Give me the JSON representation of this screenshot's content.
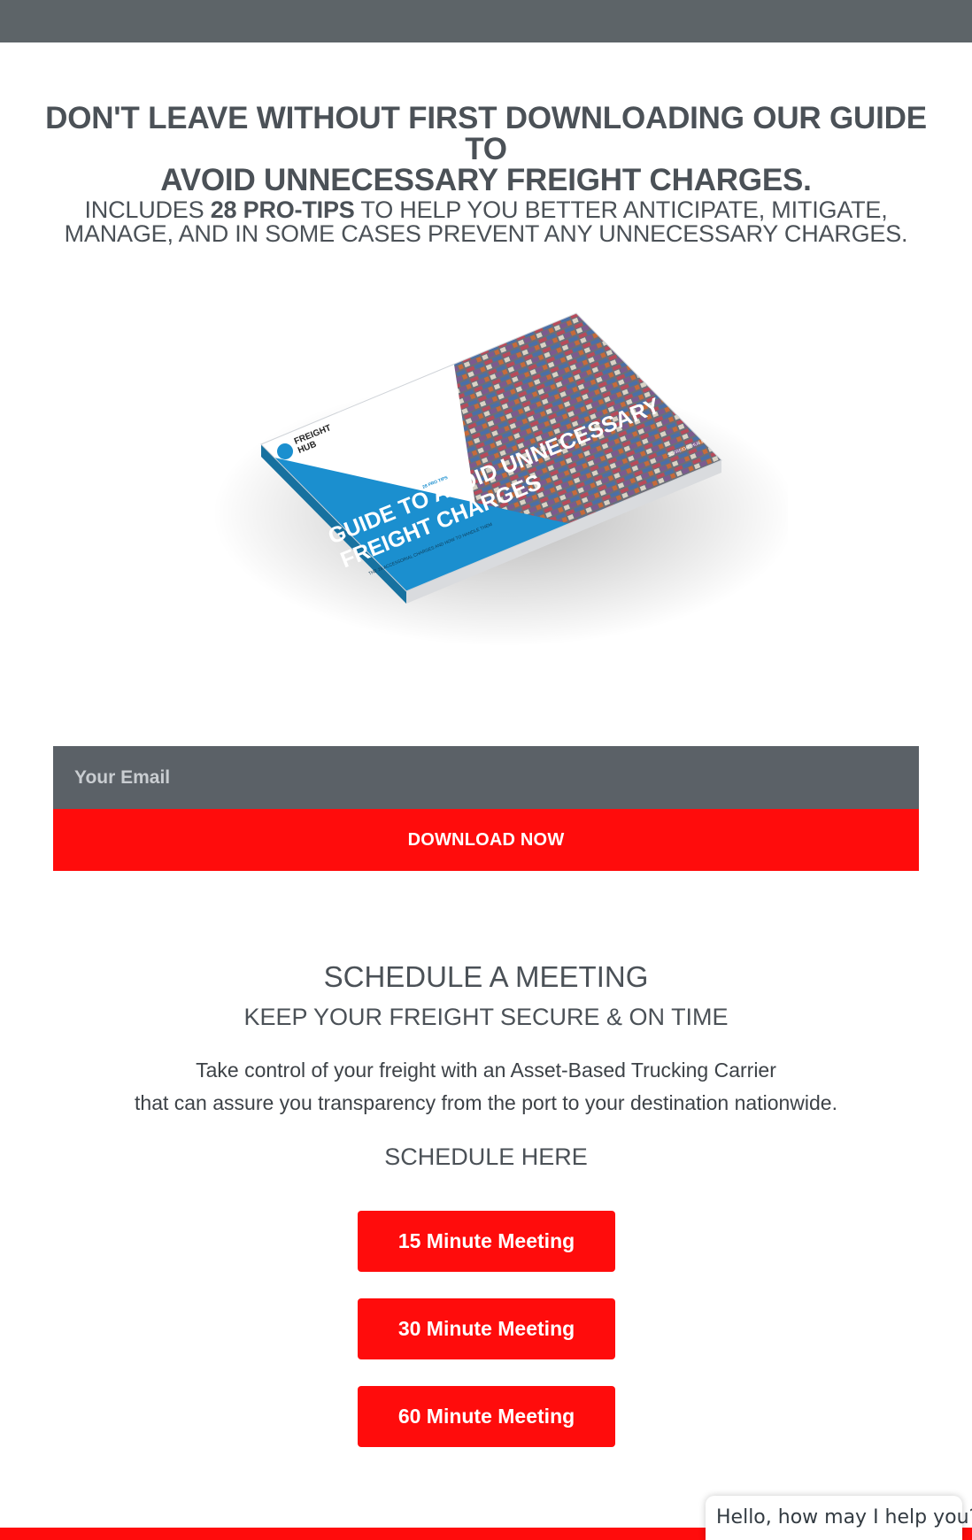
{
  "headline": {
    "prefix": "DON'T LEAVE WITHOUT FIRST DOWNLOADING OUR ",
    "bold_1": "GUIDE TO",
    "bold_2": "AVOID UNNECESSARY FREIGHT CHARGES."
  },
  "subline": {
    "prefix": "INCLUDES ",
    "bold": "28 PRO-TIPS",
    "suffix_1": " TO HELP YOU BETTER ANTICIPATE, MITIGATE,",
    "suffix_2": "MANAGE, AND IN SOME CASES PREVENT ANY UNNECESSARY CHARGES."
  },
  "book": {
    "brand_line_1": "FREIGHT",
    "brand_line_2": "HUB",
    "badge": "28 PRO TIPS",
    "title_line_1": "GUIDE TO AVOID UNNECESSARY",
    "title_line_2": "FREIGHT CHARGES",
    "subtitle": "THE 28 ACCESSORIAL CHARGES AND HOW TO HANDLE THEM",
    "spine_text": "SCFREIGHTHUB.IO",
    "colors": {
      "blue": "#1b8fcf",
      "white": "#ffffff"
    }
  },
  "form": {
    "email_placeholder": "Your Email",
    "download_label": "DOWNLOAD NOW"
  },
  "schedule": {
    "title": "SCHEDULE A MEETING",
    "subtitle": "KEEP YOUR FREIGHT SECURE & ON TIME",
    "description_line_1": "Take control of your freight with an Asset-Based Trucking Carrier",
    "description_line_2": "that can assure you transparency from the port to your destination nationwide.",
    "cta": "SCHEDULE HERE",
    "buttons": [
      "15 Minute Meeting",
      "30 Minute Meeting",
      "60 Minute Meeting"
    ]
  },
  "chat": {
    "greeting": "Hello, how may I help you?"
  },
  "colors": {
    "accent_red": "#ff0c0c",
    "dark_gray": "#5b6167",
    "text_gray": "#4b5157"
  }
}
